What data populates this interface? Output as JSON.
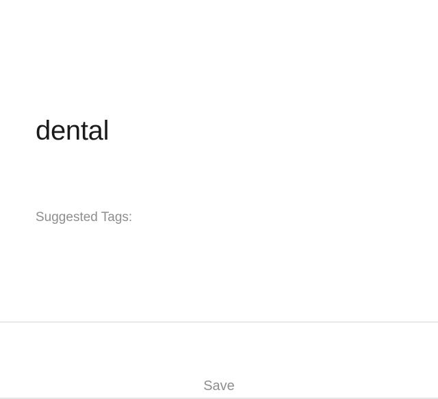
{
  "tag_editor": {
    "input_value": "dental",
    "suggested_label": "Suggested Tags:",
    "suggested_tags": []
  },
  "footer": {
    "save_label": "Save"
  }
}
